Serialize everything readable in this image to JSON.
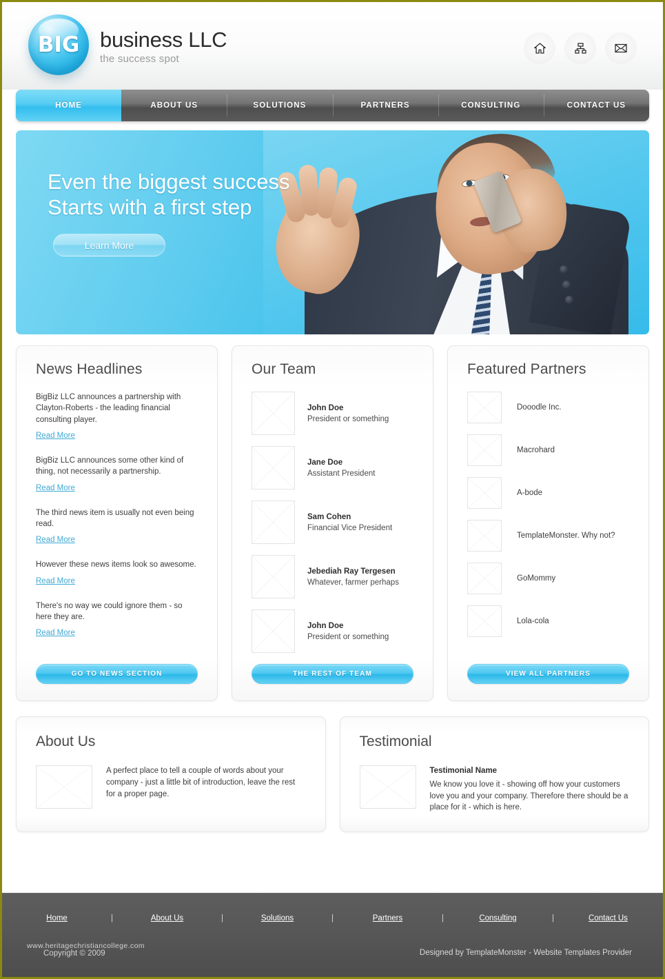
{
  "brand": {
    "logo_badge": "BIG",
    "title": "business LLC",
    "tagline": "the success spot"
  },
  "header_icons": [
    {
      "name": "home-icon",
      "label": "Home"
    },
    {
      "name": "sitemap-icon",
      "label": "Sitemap"
    },
    {
      "name": "email-icon",
      "label": "Email"
    }
  ],
  "nav": {
    "items": [
      {
        "label": "HOME",
        "active": true
      },
      {
        "label": "ABOUT US",
        "active": false
      },
      {
        "label": "SOLUTIONS",
        "active": false
      },
      {
        "label": "PARTNERS",
        "active": false
      },
      {
        "label": "CONSULTING",
        "active": false
      },
      {
        "label": "CONTACT US",
        "active": false
      }
    ]
  },
  "hero": {
    "line1": "Even the biggest success",
    "line2": "Starts with a first step",
    "button": "Learn More"
  },
  "news": {
    "title": "News Headlines",
    "items": [
      {
        "text": "BigBiz LLC announces a partnership with Clayton-Roberts - the leading financial consulting player.",
        "link": "Read More"
      },
      {
        "text": "BigBiz LLC announces some other kind of thing, not necessarily a partnership.",
        "link": "Read More"
      },
      {
        "text": "The third news item is usually not even being read.",
        "link": "Read More"
      },
      {
        "text": "However these news items look so awesome.",
        "link": "Read More"
      },
      {
        "text": "There's no way  we could ignore them - so here they are.",
        "link": "Read More"
      }
    ],
    "button": "GO TO NEWS SECTION"
  },
  "team": {
    "title": "Our Team",
    "members": [
      {
        "name": "John Doe",
        "role": "President or something"
      },
      {
        "name": "Jane Doe",
        "role": "Assistant President"
      },
      {
        "name": "Sam Cohen",
        "role": "Financial Vice President"
      },
      {
        "name": "Jebediah Ray Tergesen",
        "role": "Whatever, farmer perhaps"
      },
      {
        "name": "John Doe",
        "role": "President or something"
      }
    ],
    "button": "THE REST OF TEAM"
  },
  "partners": {
    "title": "Featured Partners",
    "items": [
      {
        "name": "Dooodle Inc."
      },
      {
        "name": "Macrohard"
      },
      {
        "name": "A-bode"
      },
      {
        "name": "TemplateMonster. Why not?"
      },
      {
        "name": "GoMommy"
      },
      {
        "name": "Lola-cola"
      }
    ],
    "button": "VIEW ALL PARTNERS"
  },
  "about": {
    "title": "About Us",
    "text": "A perfect place to tell a couple of words about your company - just a little bit of introduction, leave the rest for a proper page."
  },
  "testimonial": {
    "title": "Testimonial",
    "name": "Testimonial Name",
    "text": "We know you love it - showing off how your customers love you and your company. Therefore there should be a place for it - which is here."
  },
  "footer": {
    "links": [
      "Home",
      "About Us",
      "Solutions",
      "Partners",
      "Consulting",
      "Contact Us"
    ],
    "separator": "|",
    "copyright": "Copyright © 2009",
    "credit": "Designed by TemplateMonster - Website Templates Provider",
    "watermark": "www.heritagechristiancollege.com"
  },
  "colors": {
    "accent": "#3fc0ee",
    "accent_light": "#7cd9f5",
    "nav_dark": "#5b5b5b",
    "footer": "#585858",
    "page_border": "#8a8a0f",
    "link": "#3fa9d4"
  }
}
